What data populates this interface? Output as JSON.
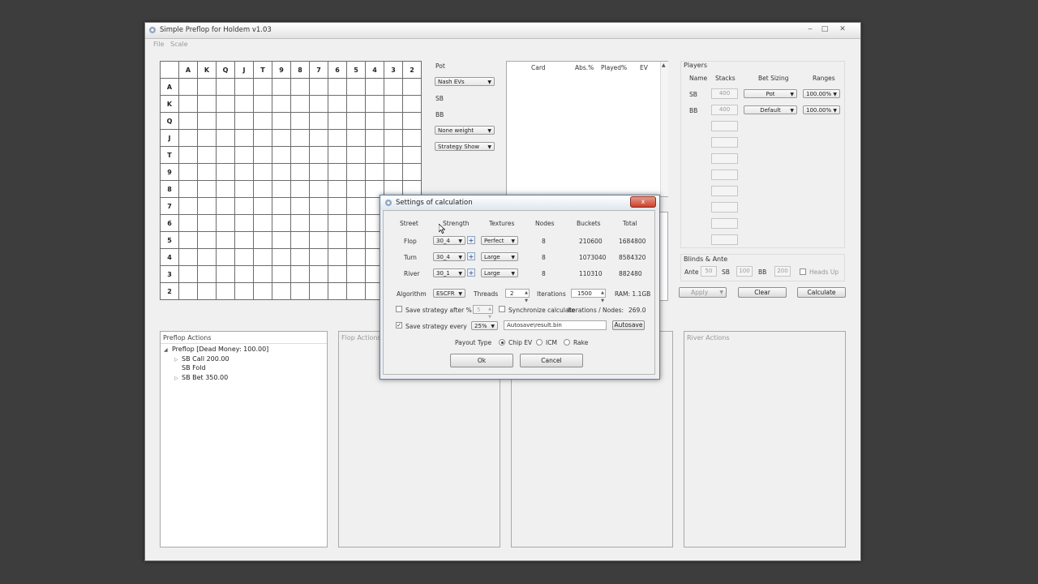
{
  "window": {
    "title": "Simple Preflop for Holdem v1.03"
  },
  "menu": [
    "File",
    "Scale"
  ],
  "grid": {
    "columns": [
      "A",
      "K",
      "Q",
      "J",
      "T",
      "9",
      "8",
      "7",
      "6",
      "5",
      "4",
      "3",
      "2"
    ],
    "rows": [
      "A",
      "K",
      "Q",
      "J",
      "T",
      "9",
      "8",
      "7",
      "6",
      "5",
      "4",
      "3",
      "2"
    ]
  },
  "pot": {
    "label": "Pot",
    "ev_select": "Nash EVs",
    "sb": "SB",
    "bb": "BB",
    "weight_select": "None weight",
    "strategy_select": "Strategy Show"
  },
  "card_table": {
    "headers": [
      "Card",
      "Abs.%",
      "Played%",
      "EV"
    ]
  },
  "players": {
    "title": "Players",
    "headers": [
      "Name",
      "Stacks",
      "Bet Sizing",
      "Ranges"
    ],
    "rows": [
      {
        "name": "SB",
        "stack": "400",
        "bet": "Pot",
        "range": "100.00%"
      },
      {
        "name": "BB",
        "stack": "400",
        "bet": "Default",
        "range": "100.00%"
      }
    ]
  },
  "blinds": {
    "title": "Blinds & Ante",
    "ante_label": "Ante",
    "ante": "50",
    "sb_label": "SB",
    "sb": "100",
    "bb_label": "BB",
    "bb": "200",
    "heads_up": "Heads Up"
  },
  "buttons": {
    "apply": "Apply",
    "clear": "Clear",
    "calculate": "Calculate"
  },
  "actions": {
    "preflop_title": "Preflop Actions",
    "flop_title": "Flop Actions",
    "river_title": "River Actions",
    "tree": [
      {
        "label": "Preflop [Dead Money: 100.00]",
        "expander": "◢"
      },
      {
        "label": "SB Call 200.00",
        "expander": "▷"
      },
      {
        "label": "SB Fold",
        "expander": ""
      },
      {
        "label": "SB Bet 350.00",
        "expander": "▷"
      }
    ]
  },
  "dialog": {
    "title": "Settings of calculation",
    "close": "x",
    "headers": [
      "Street",
      "Strength",
      "Textures",
      "Nodes",
      "Buckets",
      "Total"
    ],
    "streets": [
      {
        "street": "Flop",
        "strength": "30_4",
        "texture": "Perfect",
        "nodes": "8",
        "buckets": "210600",
        "total": "1684800"
      },
      {
        "street": "Turn",
        "strength": "30_4",
        "texture": "Large",
        "nodes": "8",
        "buckets": "1073040",
        "total": "8584320"
      },
      {
        "street": "River",
        "strength": "30_1",
        "texture": "Large",
        "nodes": "8",
        "buckets": "110310",
        "total": "882480"
      }
    ],
    "algorithm_label": "Algorithm",
    "algorithm": "ESCFR",
    "threads_label": "Threads",
    "threads": "2",
    "iterations_label": "Iterations",
    "iterations": "1500",
    "ram": "RAM: 1.1GB",
    "save_after_label": "Save strategy after %",
    "save_after": "5",
    "sync_label": "Synchronize calculate",
    "iter_nodes_label": "Iterations / Nodes:",
    "iter_nodes": "269.0",
    "save_every_label": "Save strategy every",
    "save_every": "25%",
    "save_path": "Autosave\\result.bin",
    "autosave": "Autosave",
    "payout_label": "Payout Type",
    "payout_options": [
      "Chip EV",
      "ICM",
      "Rake"
    ],
    "ok": "Ok",
    "cancel": "Cancel"
  }
}
